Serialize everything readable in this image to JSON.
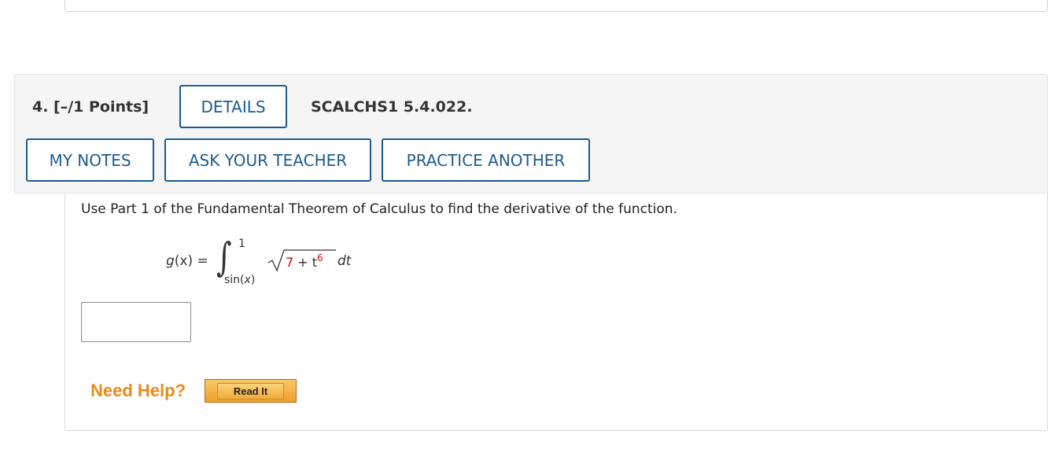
{
  "question": {
    "number_points": "4. [–/1 Points]",
    "details_label": "DETAILS",
    "code": "SCALCHS1 5.4.022.",
    "my_notes_label": "MY NOTES",
    "ask_teacher_label": "ASK YOUR TEACHER",
    "practice_label": "PRACTICE ANOTHER",
    "prompt": "Use Part 1 of the Fundamental Theorem of Calculus to find the derivative of the function.",
    "formula": {
      "lhs_fn": "g",
      "lhs_arg": "(x) =",
      "integral_sign": "∫",
      "upper_limit": "1",
      "lower_limit_fn": "sin(",
      "lower_limit_var": "x",
      "lower_limit_close": ")",
      "radicand_const": "7",
      "radicand_op": " + ",
      "radicand_var": "t",
      "radicand_exp": "6",
      "differential": "dt"
    },
    "answer_value": "",
    "need_help_label": "Need Help?",
    "read_it_label": "Read It"
  },
  "colors": {
    "button_border": "#1c5b8f",
    "need_help": "#e8891c",
    "highlight_red": "#cc1111"
  }
}
